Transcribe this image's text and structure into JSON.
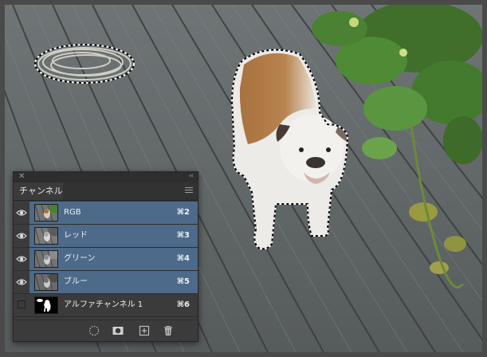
{
  "panel": {
    "close_glyph": "✕",
    "collapse_glyph": "‹‹",
    "tab_label": "チャンネル",
    "menu_icon": "panel-menu-icon"
  },
  "channels": [
    {
      "name": "RGB",
      "shortcut": "⌘2",
      "visible": true,
      "selected": true
    },
    {
      "name": "レッド",
      "shortcut": "⌘3",
      "visible": true,
      "selected": true
    },
    {
      "name": "グリーン",
      "shortcut": "⌘4",
      "visible": true,
      "selected": true
    },
    {
      "name": "ブルー",
      "shortcut": "⌘5",
      "visible": true,
      "selected": true
    },
    {
      "name": "アルファチャンネル 1",
      "shortcut": "⌘6",
      "visible": false,
      "selected": false
    }
  ],
  "footer": {
    "buttons": [
      {
        "icon": "load-selection-icon"
      },
      {
        "icon": "save-selection-icon"
      },
      {
        "icon": "new-channel-icon"
      },
      {
        "icon": "trash-icon"
      }
    ]
  },
  "colors": {
    "selection_highlight": "#4d6a8a",
    "panel_bg": "#3b3b3b"
  }
}
